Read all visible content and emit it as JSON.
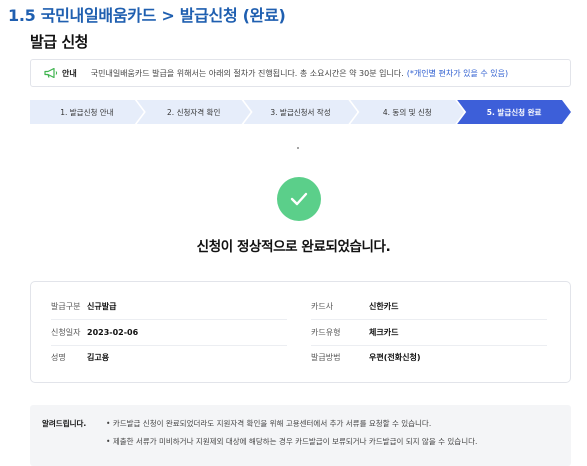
{
  "document": {
    "heading": "1.5 국민내일배움카드 > 발급신청 (완료)"
  },
  "page": {
    "title": "발급 신청"
  },
  "notice": {
    "icon": "megaphone-icon",
    "label": "안내",
    "text": "국민내일배움카드 발급을 위해서는 아래의 절차가 진행됩니다. 총 소요시간은 약 30분 입니다.",
    "hint": "(*개인별 편차가 있을 수 있음)"
  },
  "steps": [
    {
      "label": "1. 발급신청 안내",
      "active": false
    },
    {
      "label": "2. 신청자격 확인",
      "active": false
    },
    {
      "label": "3. 발급신청서 작성",
      "active": false
    },
    {
      "label": "4. 동의 및 신청",
      "active": false
    },
    {
      "label": "5. 발급신청 완료",
      "active": true
    }
  ],
  "result": {
    "icon": "check-icon",
    "message": "신청이 정상적으로 완료되었습니다."
  },
  "details": {
    "issue_type": {
      "label": "발급구분",
      "value": "신규발급"
    },
    "apply_date": {
      "label": "신청일자",
      "value": "2023-02-06"
    },
    "name": {
      "label": "성명",
      "value": "김고용"
    },
    "card_company": {
      "label": "카드사",
      "value": "신한카드"
    },
    "card_type": {
      "label": "카드유형",
      "value": "체크카드"
    },
    "issue_method": {
      "label": "발급방법",
      "value": "우편(전화신청)"
    }
  },
  "footer": {
    "title": "알려드립니다.",
    "items": [
      "카드발급 신청이 완료되었더라도 지원자격 확인을 위해 고용센터에서 추가 서류를 요청할 수 있습니다.",
      "제출한 서류가 미비하거나 지원제외 대상에 해당하는 경우 카드발급이 보류되거나 카드발급이 되지 않을 수 있습니다."
    ]
  },
  "colors": {
    "heading_blue": "#1f5fb0",
    "step_active": "#3d5fd9",
    "step_inactive": "#e6edfa",
    "success_green": "#5bcf8a",
    "notice_icon_green": "#3fb34f"
  }
}
